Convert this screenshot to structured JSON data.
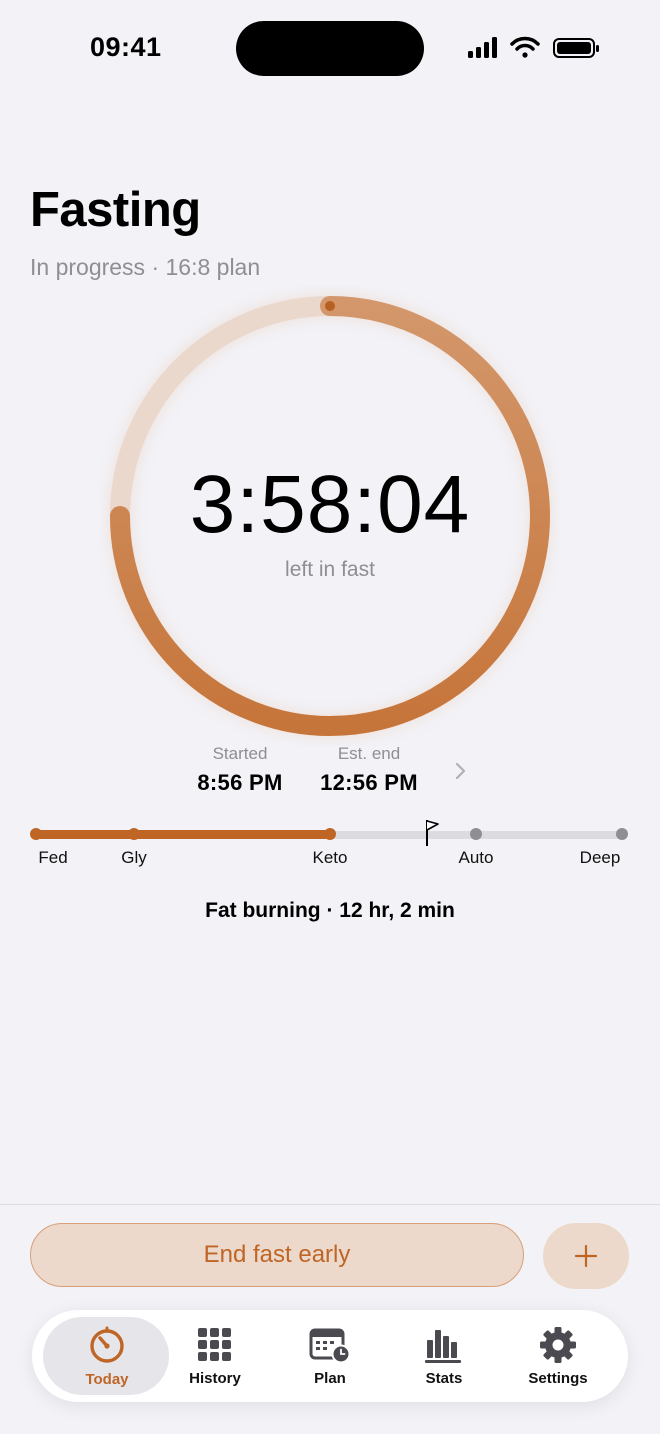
{
  "status_bar": {
    "time": "09:41"
  },
  "header": {
    "title": "Fasting",
    "subtitle": "In progress · 16:8 plan"
  },
  "timer": {
    "countdown": "3:58:04",
    "label": "left in fast",
    "progress_fraction": 0.75
  },
  "times": {
    "started_label": "Started",
    "started_value": "8:56 PM",
    "end_label": "Est. end",
    "end_value": "12:56 PM"
  },
  "stages": {
    "items": [
      {
        "label": "Fed",
        "reached": true
      },
      {
        "label": "Gly",
        "reached": true
      },
      {
        "label": "Keto",
        "reached": true
      },
      {
        "label": "Auto",
        "reached": false
      },
      {
        "label": "Deep",
        "reached": false
      }
    ],
    "status": "Fat burning · 12 hr, 2 min"
  },
  "actions": {
    "end_label": "End fast early",
    "add_icon": "plus-icon"
  },
  "tabbar": {
    "items": [
      {
        "label": "Today",
        "icon": "timer-icon",
        "selected": true
      },
      {
        "label": "History",
        "icon": "grid-icon",
        "selected": false
      },
      {
        "label": "Plan",
        "icon": "calendar-clock-icon",
        "selected": false
      },
      {
        "label": "Stats",
        "icon": "bar-chart-icon",
        "selected": false
      },
      {
        "label": "Settings",
        "icon": "gear-icon",
        "selected": false
      }
    ]
  },
  "colors": {
    "accent": "#bf6526",
    "background": "#f2f2f7",
    "button_fill": "#ecd9cc"
  }
}
